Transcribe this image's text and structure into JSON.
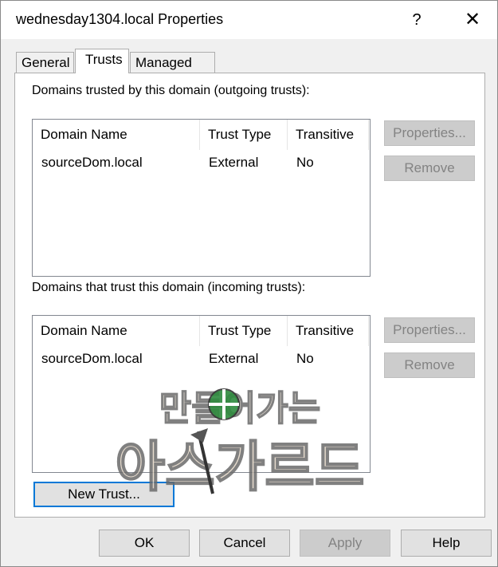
{
  "window": {
    "title": "wednesday1304.local Properties",
    "help_glyph": "?",
    "close_glyph": "✕"
  },
  "tabs": [
    {
      "label": "General",
      "active": false
    },
    {
      "label": "Trusts",
      "active": true
    },
    {
      "label": "Managed By",
      "active": false
    }
  ],
  "outgoing": {
    "label": "Domains trusted by this domain (outgoing trusts):",
    "columns": [
      "Domain Name",
      "Trust Type",
      "Transitive"
    ],
    "rows": [
      {
        "domain": "sourceDom.local",
        "type": "External",
        "transitive": "No"
      }
    ],
    "properties_label": "Properties...",
    "remove_label": "Remove"
  },
  "incoming": {
    "label": "Domains that trust this domain (incoming trusts):",
    "columns": [
      "Domain Name",
      "Trust Type",
      "Transitive"
    ],
    "rows": [
      {
        "domain": "sourceDom.local",
        "type": "External",
        "transitive": "No"
      }
    ],
    "properties_label": "Properties...",
    "remove_label": "Remove"
  },
  "new_trust_label": "New Trust...",
  "footer": {
    "ok": "OK",
    "cancel": "Cancel",
    "apply": "Apply",
    "help": "Help"
  },
  "watermark": {
    "line1": "만들어가는",
    "line2": "아스가르드"
  },
  "colors": {
    "focus": "#0078d7",
    "disabled_text": "#838383"
  }
}
